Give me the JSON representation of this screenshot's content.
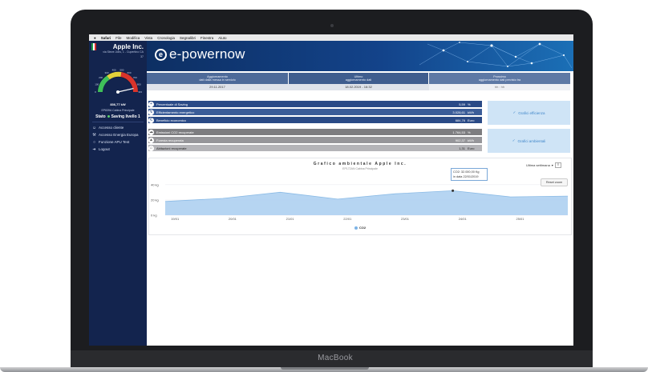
{
  "device": {
    "brand": "MacBook"
  },
  "menubar": {
    "items": [
      "Safari",
      "File",
      "Modifica",
      "Vista",
      "Cronologia",
      "Segnalibri",
      "Finestra",
      "Aiuto"
    ]
  },
  "sidebar": {
    "company": "Apple Inc.",
    "address": "via Steve Jobs, 1 - Cupertino CA",
    "code": "37",
    "power": "836,77 kW",
    "cabin": "EP839A Cabina Principale",
    "status_label": "Stato",
    "status_value": "Saving livello 1",
    "gauge_ticks": [
      "0",
      "100",
      "200",
      "300",
      "400",
      "500",
      "600",
      "700",
      "800",
      "900"
    ],
    "gauge_level": 0.93,
    "nav": [
      {
        "label": "Accesso cliente",
        "icon": "user-icon"
      },
      {
        "label": "Accesso Energia Europa",
        "icon": "wrench-icon"
      },
      {
        "label": "Funzione APU Test",
        "icon": "circle-icon"
      },
      {
        "label": "Logout",
        "icon": "logout-icon"
      }
    ]
  },
  "banner": {
    "logo_text": "e-powernow"
  },
  "updates": [
    {
      "head1": "Aggiornamento",
      "head2": "dati dalla messa in servizio",
      "value": "29.11.2017"
    },
    {
      "head1": "Ultimo",
      "head2": "aggiornamento dati",
      "value": "18.02.2019 - 16:32"
    },
    {
      "head1": "Prossimo",
      "head2": "aggiornamento dati previsto tra",
      "value": "hh : hh"
    }
  ],
  "metrics_primary": [
    {
      "label": "Percentuale di Saving",
      "value": "5,59",
      "unit": "%"
    },
    {
      "label": "Efficientamento energetico",
      "value": "3.028,61",
      "unit": "kWh"
    },
    {
      "label": "Beneficio economico",
      "value": "684,76",
      "unit": "Euro"
    }
  ],
  "metrics_env": [
    {
      "label": "Emissioni CO2 recuperate",
      "value": "1.764,53",
      "unit": "%"
    },
    {
      "label": "Foresta recuperata",
      "value": "902,37",
      "unit": "kWh"
    },
    {
      "label": "Abitazioni recuperate",
      "value": "1,31",
      "unit": "Euro"
    }
  ],
  "buttons": {
    "efficiency": "Grafici efficienza",
    "environment": "Grafici ambientali"
  },
  "chart": {
    "title": "Grafico ambientale Apple Inc.",
    "subtitle": "EP172AN Cabina Principale",
    "range_label": "Ultima settimana",
    "reset_label": "Reset zoom",
    "tooltip_line1": "CO2: 32.000,00 Kg",
    "tooltip_line2": "in data 22/01/2019",
    "legend": "CO2"
  },
  "chart_data": {
    "type": "area",
    "title": "Grafico ambientale Apple Inc.",
    "subtitle": "EP172AN Cabina Principale",
    "categories": [
      "19/01",
      "20/01",
      "21/01",
      "22/01",
      "23/01",
      "24/01",
      "25/01"
    ],
    "y_ticks": [
      "0 kg",
      "20 kg",
      "40 kg"
    ],
    "ylim": [
      0,
      45
    ],
    "series": [
      {
        "name": "CO2",
        "values": [
          18,
          22,
          30,
          21,
          28,
          32,
          24,
          25
        ]
      }
    ],
    "colors": {
      "fill": "#a9cef0",
      "line": "#8bbbe6"
    },
    "grid": true,
    "legend": "bottom-center"
  }
}
